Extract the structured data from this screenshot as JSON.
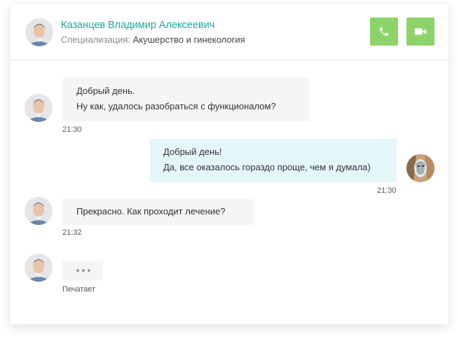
{
  "header": {
    "doctor_name": "Казанцев Владимир Алексеевич",
    "specialization_label": "Специализация:",
    "specialization_value": "Акушерство и гинекология",
    "voice_call_icon": "phone-icon",
    "video_call_icon": "video-camera-icon"
  },
  "messages": [
    {
      "direction": "incoming",
      "lines": [
        "Добрый день.",
        "Ну как, удалось разобраться с функционалом?"
      ],
      "time": "21:30"
    },
    {
      "direction": "outgoing",
      "lines": [
        "Добрый день!",
        "Да, все оказалось гораздо проще, чем я думала)"
      ],
      "time": "21:30"
    },
    {
      "direction": "incoming",
      "lines": [
        "Прекрасно. Как проходит лечение?"
      ],
      "time": "21:32"
    }
  ],
  "typing": {
    "status": "Печатает"
  },
  "colors": {
    "accent_teal": "#17a9a6",
    "call_button_green": "#8cd46a",
    "incoming_bubble": "#f6f4f5",
    "outgoing_bubble": "#e4f6f7"
  }
}
